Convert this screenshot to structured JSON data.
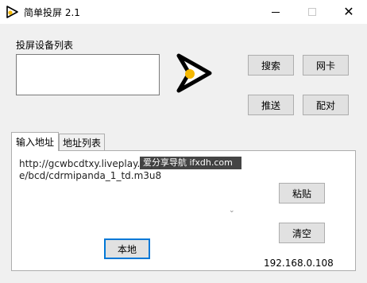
{
  "window": {
    "title": "简单投屏 2.1",
    "controls": {
      "minimize": "minimize-icon",
      "maximize": "maximize-icon",
      "close": "close-icon",
      "close_glyph": "✕"
    }
  },
  "device_section": {
    "label": "投屏设备列表",
    "items": []
  },
  "buttons": {
    "search": "搜索",
    "network_card": "网卡",
    "push": "推送",
    "pair": "配对",
    "paste": "粘贴",
    "clear": "清空",
    "local": "本地"
  },
  "tabs": [
    {
      "label": "输入地址",
      "active": true
    },
    {
      "label": "地址列表",
      "active": false
    }
  ],
  "url_input": {
    "value": "http://gcwbcdtxy.liveplay.myqcloud.com/live/bcd/cdrmipanda_1_td.m3u8"
  },
  "watermark": {
    "text": "爱分享导航 ifxdh.com"
  },
  "status": {
    "ip": "192.168.0.108"
  },
  "colors": {
    "play_yellow": "#f5b800",
    "play_outline": "#000000",
    "focus_border": "#0078d7"
  }
}
